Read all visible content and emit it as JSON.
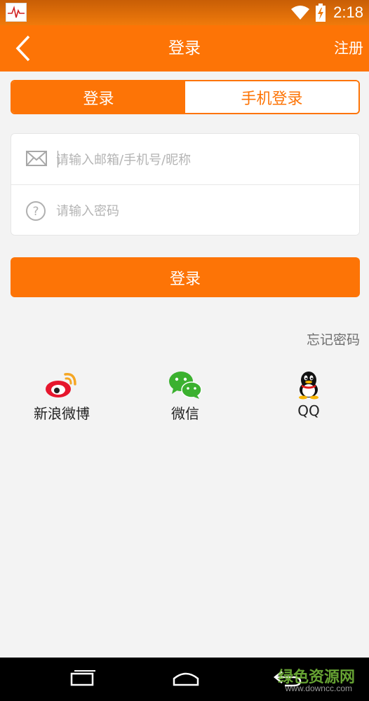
{
  "status_bar": {
    "time": "2:18",
    "icons": [
      "app-notification-icon",
      "wifi-icon",
      "battery-charging-icon"
    ]
  },
  "app_bar": {
    "title": "登录",
    "register_label": "注册",
    "back_icon": "chevron-left-icon"
  },
  "tabs": [
    {
      "label": "登录",
      "active": true
    },
    {
      "label": "手机登录",
      "active": false
    }
  ],
  "form": {
    "account": {
      "placeholder": "请输入邮箱/手机号/昵称",
      "value": "",
      "icon": "mail-icon"
    },
    "password": {
      "placeholder": "请输入密码",
      "value": "",
      "icon": "question-icon"
    }
  },
  "login_button": "登录",
  "forgot_password": "忘记密码",
  "social": [
    {
      "label": "新浪微博",
      "icon": "weibo-icon"
    },
    {
      "label": "微信",
      "icon": "wechat-icon"
    },
    {
      "label": "QQ",
      "icon": "qq-icon"
    }
  ],
  "colors": {
    "brand": "#fd7406",
    "background": "#f3f3f3"
  },
  "watermark": {
    "main": "绿色资源网",
    "sub": "www.downcc.com"
  }
}
